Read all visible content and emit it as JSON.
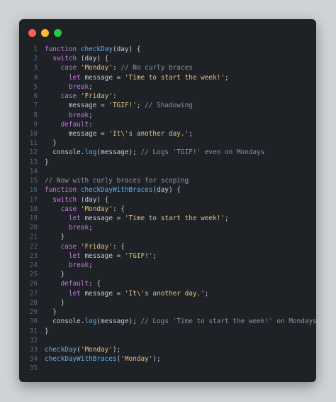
{
  "window": {
    "controls": [
      {
        "name": "close-button",
        "color": "#ff5f57"
      },
      {
        "name": "minimize-button",
        "color": "#febc2e"
      },
      {
        "name": "maximize-button",
        "color": "#28c840"
      }
    ]
  },
  "code": {
    "lines": [
      {
        "n": "1",
        "tokens": [
          [
            "kw",
            "function "
          ],
          [
            "fn",
            "checkDay"
          ],
          [
            "pl",
            "(day) {"
          ]
        ]
      },
      {
        "n": "2",
        "tokens": [
          [
            "pl",
            "  "
          ],
          [
            "kw",
            "switch"
          ],
          [
            "pl",
            " (day) {"
          ]
        ]
      },
      {
        "n": "3",
        "tokens": [
          [
            "pl",
            "    "
          ],
          [
            "kw",
            "case "
          ],
          [
            "str",
            "'Monday'"
          ],
          [
            "pl",
            ": "
          ],
          [
            "cm",
            "// No curly braces"
          ]
        ]
      },
      {
        "n": "4",
        "tokens": [
          [
            "pl",
            "      "
          ],
          [
            "kw",
            "let "
          ],
          [
            "pl",
            "message = "
          ],
          [
            "str",
            "'Time to start the week!'"
          ],
          [
            "pl",
            ";"
          ]
        ]
      },
      {
        "n": "5",
        "tokens": [
          [
            "pl",
            "      "
          ],
          [
            "kw",
            "break"
          ],
          [
            "pl",
            ";"
          ]
        ]
      },
      {
        "n": "6",
        "tokens": [
          [
            "pl",
            "    "
          ],
          [
            "kw",
            "case "
          ],
          [
            "str",
            "'Friday'"
          ],
          [
            "pl",
            ":"
          ]
        ]
      },
      {
        "n": "7",
        "tokens": [
          [
            "pl",
            "      message = "
          ],
          [
            "str",
            "'TGIF!'"
          ],
          [
            "pl",
            "; "
          ],
          [
            "cm",
            "// Shadowing"
          ]
        ]
      },
      {
        "n": "8",
        "tokens": [
          [
            "pl",
            "      "
          ],
          [
            "kw",
            "break"
          ],
          [
            "pl",
            ";"
          ]
        ]
      },
      {
        "n": "9",
        "tokens": [
          [
            "pl",
            "    "
          ],
          [
            "kw",
            "default"
          ],
          [
            "pl",
            ":"
          ]
        ]
      },
      {
        "n": "10",
        "tokens": [
          [
            "pl",
            "      message = "
          ],
          [
            "str",
            "'It\\'s another day.'"
          ],
          [
            "pl",
            ";"
          ]
        ]
      },
      {
        "n": "11",
        "tokens": [
          [
            "pl",
            "  }"
          ]
        ]
      },
      {
        "n": "12",
        "tokens": [
          [
            "pl",
            "  console."
          ],
          [
            "fn",
            "log"
          ],
          [
            "pl",
            "(message); "
          ],
          [
            "cm",
            "// Logs 'TGIF!' even on Mondays"
          ]
        ]
      },
      {
        "n": "13",
        "tokens": [
          [
            "pl",
            "}"
          ]
        ]
      },
      {
        "n": "14",
        "tokens": [
          [
            "pl",
            ""
          ]
        ]
      },
      {
        "n": "15",
        "tokens": [
          [
            "cm",
            "// Now with curly braces for scoping"
          ]
        ]
      },
      {
        "n": "16",
        "tokens": [
          [
            "kw",
            "function "
          ],
          [
            "fn",
            "checkDayWithBraces"
          ],
          [
            "pl",
            "(day) {"
          ]
        ]
      },
      {
        "n": "17",
        "tokens": [
          [
            "pl",
            "  "
          ],
          [
            "kw",
            "switch"
          ],
          [
            "pl",
            " (day) {"
          ]
        ]
      },
      {
        "n": "18",
        "tokens": [
          [
            "pl",
            "    "
          ],
          [
            "kw",
            "case "
          ],
          [
            "str",
            "'Monday'"
          ],
          [
            "pl",
            ": {"
          ]
        ]
      },
      {
        "n": "19",
        "tokens": [
          [
            "pl",
            "      "
          ],
          [
            "kw",
            "let "
          ],
          [
            "pl",
            "message = "
          ],
          [
            "str",
            "'Time to start the week!'"
          ],
          [
            "pl",
            ";"
          ]
        ]
      },
      {
        "n": "20",
        "tokens": [
          [
            "pl",
            "      "
          ],
          [
            "kw",
            "break"
          ],
          [
            "pl",
            ";"
          ]
        ]
      },
      {
        "n": "21",
        "tokens": [
          [
            "pl",
            "    }"
          ]
        ]
      },
      {
        "n": "22",
        "tokens": [
          [
            "pl",
            "    "
          ],
          [
            "kw",
            "case "
          ],
          [
            "str",
            "'Friday'"
          ],
          [
            "pl",
            ": {"
          ]
        ]
      },
      {
        "n": "23",
        "tokens": [
          [
            "pl",
            "      "
          ],
          [
            "kw",
            "let "
          ],
          [
            "pl",
            "message = "
          ],
          [
            "str",
            "'TGIF!'"
          ],
          [
            "pl",
            ";"
          ]
        ]
      },
      {
        "n": "24",
        "tokens": [
          [
            "pl",
            "      "
          ],
          [
            "kw",
            "break"
          ],
          [
            "pl",
            ";"
          ]
        ]
      },
      {
        "n": "25",
        "tokens": [
          [
            "pl",
            "    }"
          ]
        ]
      },
      {
        "n": "26",
        "tokens": [
          [
            "pl",
            "    "
          ],
          [
            "kw",
            "default"
          ],
          [
            "pl",
            ": {"
          ]
        ]
      },
      {
        "n": "27",
        "tokens": [
          [
            "pl",
            "      "
          ],
          [
            "kw",
            "let "
          ],
          [
            "pl",
            "message = "
          ],
          [
            "str",
            "'It\\'s another day.'"
          ],
          [
            "pl",
            ";"
          ]
        ]
      },
      {
        "n": "28",
        "tokens": [
          [
            "pl",
            "    }"
          ]
        ]
      },
      {
        "n": "29",
        "tokens": [
          [
            "pl",
            "  }"
          ]
        ]
      },
      {
        "n": "30",
        "tokens": [
          [
            "pl",
            "  console."
          ],
          [
            "fn",
            "log"
          ],
          [
            "pl",
            "(message); "
          ],
          [
            "cm",
            "// Logs 'Time to start the week!' on Mondays"
          ]
        ]
      },
      {
        "n": "31",
        "tokens": [
          [
            "pl",
            "}"
          ]
        ]
      },
      {
        "n": "32",
        "tokens": [
          [
            "pl",
            ""
          ]
        ]
      },
      {
        "n": "33",
        "tokens": [
          [
            "fn",
            "checkDay"
          ],
          [
            "pl",
            "("
          ],
          [
            "str",
            "'Monday'"
          ],
          [
            "pl",
            ");"
          ]
        ]
      },
      {
        "n": "34",
        "tokens": [
          [
            "fn",
            "checkDayWithBraces"
          ],
          [
            "pl",
            "("
          ],
          [
            "str",
            "'Monday'"
          ],
          [
            "pl",
            ");"
          ]
        ]
      },
      {
        "n": "35",
        "tokens": [
          [
            "pl",
            ""
          ]
        ]
      }
    ]
  }
}
